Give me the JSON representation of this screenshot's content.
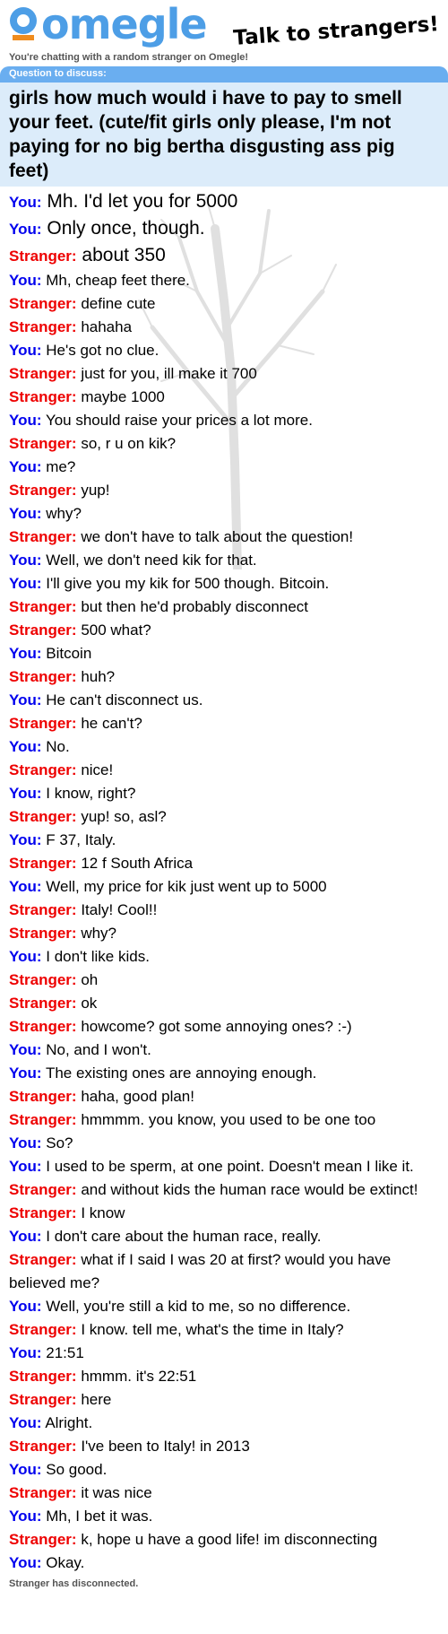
{
  "header": {
    "logo_text": "omegle",
    "tagline": "Talk to strangers!",
    "subtitle": "You're chatting with a random stranger on Omegle!"
  },
  "question": {
    "label": "Question to discuss:",
    "text": "girls how much would i have to pay to smell your feet.  (cute/fit girls only please, I'm not paying for no big bertha disgusting ass pig feet)"
  },
  "messages": [
    {
      "who": "You:",
      "text": "Mh. I'd let you for 5000",
      "big": true
    },
    {
      "who": "You:",
      "text": "Only once, though.",
      "big": true
    },
    {
      "who": "Stranger:",
      "text": "about 350",
      "big": true
    },
    {
      "who": "You:",
      "text": "Mh, cheap feet there."
    },
    {
      "who": "Stranger:",
      "text": "define cute"
    },
    {
      "who": "Stranger:",
      "text": "hahaha"
    },
    {
      "who": "You:",
      "text": "He's got no clue."
    },
    {
      "who": "Stranger:",
      "text": "just for you, ill make it 700"
    },
    {
      "who": "Stranger:",
      "text": "maybe 1000"
    },
    {
      "who": "You:",
      "text": "You should raise your prices a lot more."
    },
    {
      "who": "Stranger:",
      "text": "so, r u on kik?"
    },
    {
      "who": "You:",
      "text": "me?"
    },
    {
      "who": "Stranger:",
      "text": "yup!"
    },
    {
      "who": "You:",
      "text": "why?"
    },
    {
      "who": "Stranger:",
      "text": "we don't have to talk about the question!"
    },
    {
      "who": "You:",
      "text": "Well, we don't need kik for that."
    },
    {
      "who": "You:",
      "text": "I'll give you my kik for 500 though. Bitcoin."
    },
    {
      "who": "Stranger:",
      "text": "but then he'd probably disconnect"
    },
    {
      "who": "Stranger:",
      "text": "500 what?"
    },
    {
      "who": "You:",
      "text": "Bitcoin"
    },
    {
      "who": "Stranger:",
      "text": "huh?"
    },
    {
      "who": "You:",
      "text": "He can't disconnect us."
    },
    {
      "who": "Stranger:",
      "text": "he can't?"
    },
    {
      "who": "You:",
      "text": "No."
    },
    {
      "who": "Stranger:",
      "text": "nice!"
    },
    {
      "who": "You:",
      "text": "I know, right?"
    },
    {
      "who": "Stranger:",
      "text": "yup! so, asl?"
    },
    {
      "who": "You:",
      "text": "F 37, Italy."
    },
    {
      "who": "Stranger:",
      "text": "12 f South Africa"
    },
    {
      "who": "You:",
      "text": "Well, my price for kik just went up to 5000"
    },
    {
      "who": "Stranger:",
      "text": "Italy!  Cool!!"
    },
    {
      "who": "Stranger:",
      "text": "why?"
    },
    {
      "who": "You:",
      "text": "I don't like kids."
    },
    {
      "who": "Stranger:",
      "text": "oh"
    },
    {
      "who": "Stranger:",
      "text": "ok"
    },
    {
      "who": "Stranger:",
      "text": "howcome? got some annoying ones? :-)"
    },
    {
      "who": "You:",
      "text": "No, and I won't."
    },
    {
      "who": "You:",
      "text": "The existing ones are annoying enough."
    },
    {
      "who": "Stranger:",
      "text": "haha, good plan!"
    },
    {
      "who": "Stranger:",
      "text": "hmmmm. you know,  you used to be one too"
    },
    {
      "who": "You:",
      "text": "So?"
    },
    {
      "who": "You:",
      "text": "I used to be sperm, at one point. Doesn't mean I like it."
    },
    {
      "who": "Stranger:",
      "text": "and without kids the human race would be extinct!"
    },
    {
      "who": "Stranger:",
      "text": "I know"
    },
    {
      "who": "You:",
      "text": "I don't care about the human race, really."
    },
    {
      "who": "Stranger:",
      "text": "what if I said I was 20 at first? would you have believed me?"
    },
    {
      "who": "You:",
      "text": "Well, you're still a kid to me, so no difference."
    },
    {
      "who": "Stranger:",
      "text": "I know. tell me, what's the time in Italy?"
    },
    {
      "who": "You:",
      "text": "21:51"
    },
    {
      "who": "Stranger:",
      "text": "hmmm. it's 22:51"
    },
    {
      "who": "Stranger:",
      "text": "here"
    },
    {
      "who": "You:",
      "text": "Alright."
    },
    {
      "who": "Stranger:",
      "text": "I've been to Italy!  in 2013"
    },
    {
      "who": "You:",
      "text": "So good."
    },
    {
      "who": "Stranger:",
      "text": "it was nice"
    },
    {
      "who": "You:",
      "text": "Mh, I bet it was."
    },
    {
      "who": "Stranger:",
      "text": "k, hope u have a good life! im disconnecting"
    },
    {
      "who": "You:",
      "text": "Okay."
    }
  ],
  "status": "Stranger has disconnected.",
  "colors": {
    "you": "#0000ee",
    "stranger": "#ee0000",
    "brand": "#4d9ee6"
  }
}
